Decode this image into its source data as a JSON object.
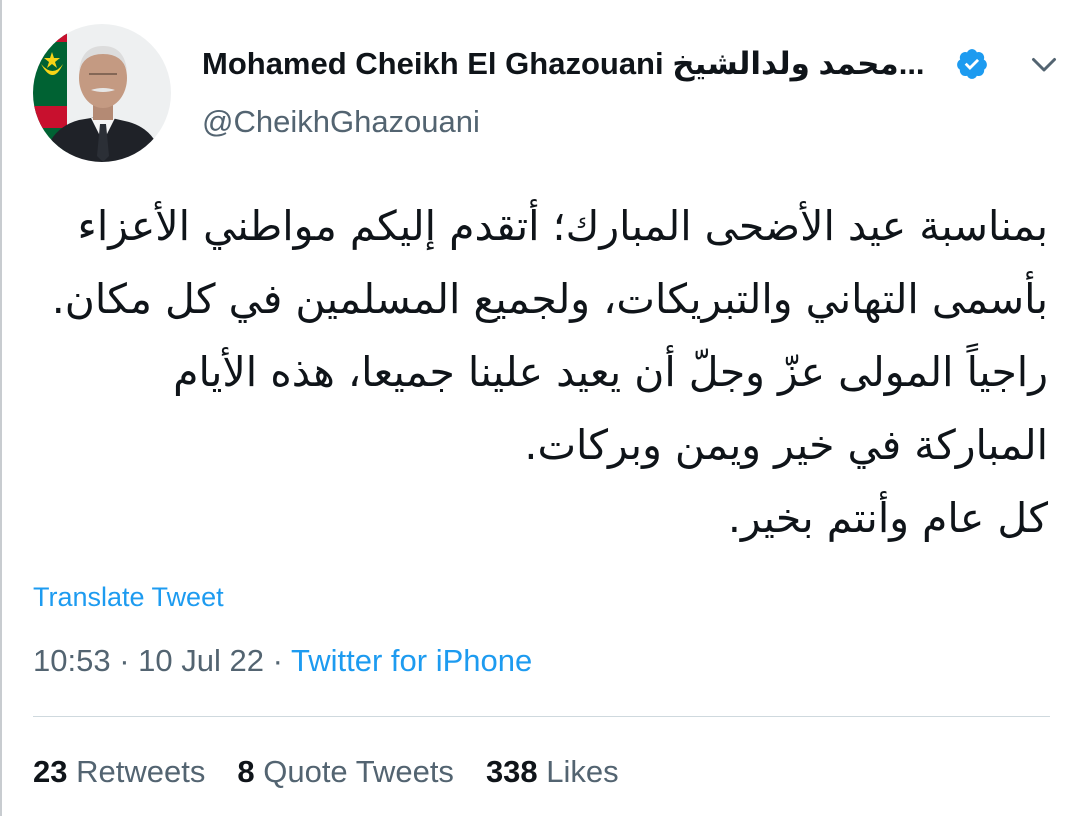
{
  "tweet": {
    "author": {
      "display_name": "Mohamed Cheikh El Ghazouani محمد ولدالشيخ...",
      "handle": "@CheikhGhazouani",
      "verified": true,
      "avatar_icon": "profile-photo"
    },
    "text_lines": [
      "بمناسبة عيد الأضحى المبارك؛ أتقدم إليكم مواطني الأعزاء",
      "بأسمى التهاني والتبريكات، ولجميع المسلمين في كل مكان.",
      "راجياً المولى عزّ وجلّ أن يعيد علينا جميعا، هذه الأيام",
      "المباركة في خير ويمن وبركات.",
      "كل عام وأنتم بخير."
    ],
    "translate_label": "Translate Tweet",
    "time": "10:53",
    "date": "10 Jul 22",
    "separator": "·",
    "source": "Twitter for iPhone",
    "stats": {
      "retweets_count": "23",
      "retweets_label": "Retweets",
      "quotes_count": "8",
      "quotes_label": "Quote Tweets",
      "likes_count": "338",
      "likes_label": "Likes"
    }
  },
  "colors": {
    "link_blue": "#1d9bf0",
    "secondary_text": "#536471",
    "primary_text": "#0f1419",
    "divider": "#cfd9de"
  }
}
